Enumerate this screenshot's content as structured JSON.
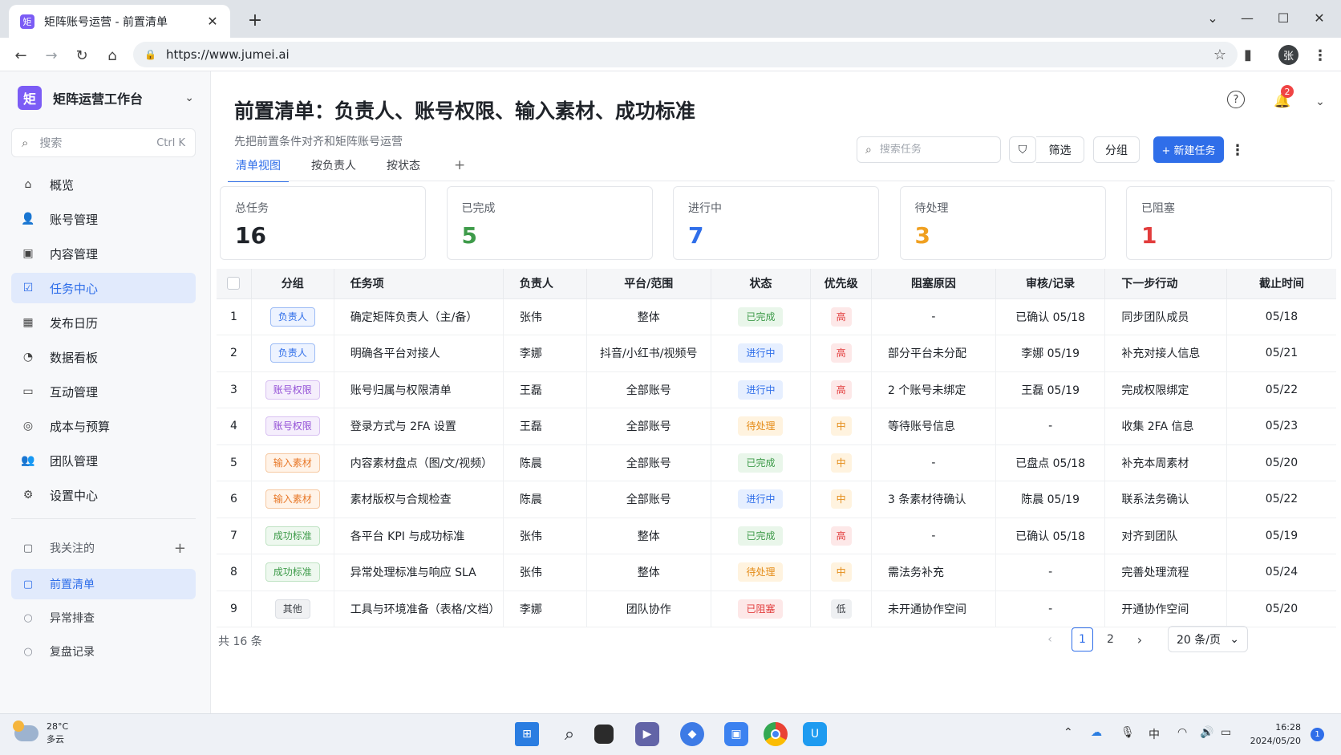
{
  "browser": {
    "tab_title": "矩阵账号运营 - 前置清单",
    "favicon_text": "矩",
    "url": "https://www.jumei.ai",
    "profile_initial": "张"
  },
  "sidebar": {
    "workspace_logo": "矩",
    "workspace_name": "矩阵运营工作台",
    "search_placeholder": "搜索",
    "search_shortcut": "Ctrl K",
    "items": [
      {
        "label": "概览",
        "icon": "home-icon"
      },
      {
        "label": "账号管理",
        "icon": "user-icon"
      },
      {
        "label": "内容管理",
        "icon": "content-icon"
      },
      {
        "label": "任务中心",
        "icon": "task-icon",
        "active": true
      },
      {
        "label": "发布日历",
        "icon": "calendar-icon"
      },
      {
        "label": "数据看板",
        "icon": "chart-icon"
      },
      {
        "label": "互动管理",
        "icon": "chat-icon"
      },
      {
        "label": "成本与预算",
        "icon": "coin-icon"
      },
      {
        "label": "团队管理",
        "icon": "team-icon"
      },
      {
        "label": "设置中心",
        "icon": "gear-icon"
      }
    ],
    "favorites_label": "我关注的",
    "favorites": [
      {
        "label": "前置清单",
        "active": true
      },
      {
        "label": "异常排查"
      },
      {
        "label": "复盘记录"
      }
    ]
  },
  "header": {
    "title": "前置清单：负责人、账号权限、输入素材、成功标准",
    "subtitle": "先把前置条件对齐和矩阵账号运营",
    "notification_count": "2"
  },
  "view_tabs": [
    "清单视图",
    "按负责人",
    "按状态"
  ],
  "toolbar": {
    "search_placeholder": "搜索任务",
    "filter_label": "筛选",
    "group_label": "分组",
    "new_task_label": "+ 新建任务"
  },
  "stats": [
    {
      "label": "总任务",
      "value": "16",
      "color": "#1f2329"
    },
    {
      "label": "已完成",
      "value": "5",
      "color": "#3e9b4a"
    },
    {
      "label": "进行中",
      "value": "7",
      "color": "#2f6ee9"
    },
    {
      "label": "待处理",
      "value": "3",
      "color": "#f0a020"
    },
    {
      "label": "已阻塞",
      "value": "1",
      "color": "#e23c3c"
    }
  ],
  "table": {
    "columns": [
      "分组",
      "任务项",
      "负责人",
      "平台/范围",
      "状态",
      "优先级",
      "阻塞原因",
      "审核/记录",
      "下一步行动",
      "截止时间"
    ],
    "rows": [
      {
        "no": "1",
        "group": "负责人",
        "gtype": "blue",
        "task": "确定矩阵负责人（主/备）",
        "owner": "张伟",
        "scope": "整体",
        "status": "已完成",
        "stype": "done",
        "priority": "高",
        "ptype": "high",
        "block": "-",
        "review": "已确认 05/18",
        "next": "同步团队成员",
        "due": "05/18"
      },
      {
        "no": "2",
        "group": "负责人",
        "gtype": "blue",
        "task": "明确各平台对接人",
        "owner": "李娜",
        "scope": "抖音/小红书/视频号",
        "status": "进行中",
        "stype": "doing",
        "priority": "高",
        "ptype": "high",
        "block": "部分平台未分配",
        "review": "李娜 05/19",
        "next": "补充对接人信息",
        "due": "05/21"
      },
      {
        "no": "3",
        "group": "账号权限",
        "gtype": "purple",
        "task": "账号归属与权限清单",
        "owner": "王磊",
        "scope": "全部账号",
        "status": "进行中",
        "stype": "doing",
        "priority": "高",
        "ptype": "high",
        "block": "2 个账号未绑定",
        "review": "王磊 05/19",
        "next": "完成权限绑定",
        "due": "05/22"
      },
      {
        "no": "4",
        "group": "账号权限",
        "gtype": "purple",
        "task": "登录方式与 2FA 设置",
        "owner": "王磊",
        "scope": "全部账号",
        "status": "待处理",
        "stype": "todo",
        "priority": "中",
        "ptype": "mid",
        "block": "等待账号信息",
        "review": "-",
        "next": "收集 2FA 信息",
        "due": "05/23"
      },
      {
        "no": "5",
        "group": "输入素材",
        "gtype": "orange",
        "task": "内容素材盘点（图/文/视频）",
        "owner": "陈晨",
        "scope": "全部账号",
        "status": "已完成",
        "stype": "done",
        "priority": "中",
        "ptype": "mid",
        "block": "-",
        "review": "已盘点 05/18",
        "next": "补充本周素材",
        "due": "05/20"
      },
      {
        "no": "6",
        "group": "输入素材",
        "gtype": "orange",
        "task": "素材版权与合规检查",
        "owner": "陈晨",
        "scope": "全部账号",
        "status": "进行中",
        "stype": "doing",
        "priority": "中",
        "ptype": "mid",
        "block": "3 条素材待确认",
        "review": "陈晨 05/19",
        "next": "联系法务确认",
        "due": "05/22"
      },
      {
        "no": "7",
        "group": "成功标准",
        "gtype": "green",
        "task": "各平台 KPI 与成功标准",
        "owner": "张伟",
        "scope": "整体",
        "status": "已完成",
        "stype": "done",
        "priority": "高",
        "ptype": "high",
        "block": "-",
        "review": "已确认 05/18",
        "next": "对齐到团队",
        "due": "05/19"
      },
      {
        "no": "8",
        "group": "成功标准",
        "gtype": "green",
        "task": "异常处理标准与响应 SLA",
        "owner": "张伟",
        "scope": "整体",
        "status": "待处理",
        "stype": "todo",
        "priority": "中",
        "ptype": "mid",
        "block": "需法务补充",
        "review": "-",
        "next": "完善处理流程",
        "due": "05/24"
      },
      {
        "no": "9",
        "group": "其他",
        "gtype": "gray",
        "task": "工具与环境准备（表格/文档）",
        "owner": "李娜",
        "scope": "团队协作",
        "status": "已阻塞",
        "stype": "block",
        "priority": "低",
        "ptype": "low",
        "block": "未开通协作空间",
        "review": "-",
        "next": "开通协作空间",
        "due": "05/20"
      }
    ]
  },
  "footer": {
    "total": "共 16 条",
    "pages": [
      "1",
      "2"
    ],
    "current_page": "1",
    "page_size": "20 条/页"
  },
  "taskbar": {
    "temperature": "28°C",
    "weather": "多云",
    "ime": "中",
    "time": "16:28",
    "date": "2024/05/20",
    "notifications": "1"
  }
}
